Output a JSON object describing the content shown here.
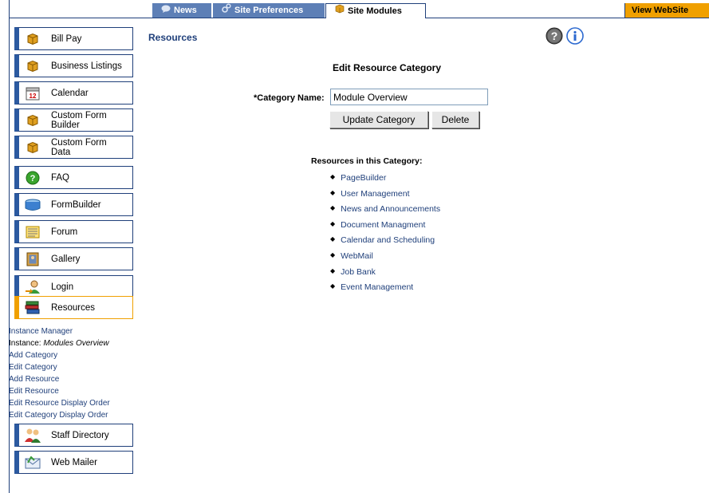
{
  "tabs": {
    "news": "News",
    "site_preferences": "Site Preferences",
    "site_modules": "Site Modules",
    "view_website": "View WebSite"
  },
  "sidebar": {
    "items": [
      {
        "label": "Bill Pay",
        "icon": "package-icon"
      },
      {
        "label": "Business Listings",
        "icon": "package-icon"
      },
      {
        "label": "Calendar",
        "icon": "calendar-icon"
      },
      {
        "label": "Custom Form Builder",
        "icon": "package-icon"
      },
      {
        "label": "Custom Form Data",
        "icon": "package-icon"
      },
      {
        "label": "FAQ",
        "icon": "question-icon"
      },
      {
        "label": "FormBuilder",
        "icon": "formbuilder-icon"
      },
      {
        "label": "Forum",
        "icon": "forum-icon"
      },
      {
        "label": "Gallery",
        "icon": "gallery-icon"
      },
      {
        "label": "Login",
        "icon": "login-icon"
      },
      {
        "label": "Resources",
        "icon": "books-icon",
        "active": true
      },
      {
        "label": "Staff Directory",
        "icon": "staff-icon"
      },
      {
        "label": "Web Mailer",
        "icon": "mail-icon"
      }
    ],
    "sub_links": {
      "instance_manager": "Instance Manager",
      "instance_prefix": "Instance:",
      "instance_name": "Modules Overview",
      "add_category": "Add Category",
      "edit_category": "Edit Category",
      "add_resource": "Add Resource",
      "edit_resource": "Edit Resource",
      "edit_resource_order": "Edit Resource Display Order",
      "edit_category_order": "Edit Category Display Order"
    }
  },
  "main": {
    "breadcrumb": "Resources",
    "form_title": "Edit Resource Category",
    "category_label": "*Category Name:",
    "category_value": "Module Overview",
    "update_button": "Update Category",
    "delete_button": "Delete",
    "resources_heading": "Resources in this Category:",
    "resources": [
      "PageBuilder",
      "User Management",
      "News and Announcements",
      "Document Managment",
      "Calendar and Scheduling",
      "WebMail",
      "Job Bank",
      "Event Management"
    ]
  },
  "colors": {
    "nav_blue": "#1f3f7a",
    "accent_orange": "#f0a000",
    "tab_blue": "#5d7fb6"
  }
}
